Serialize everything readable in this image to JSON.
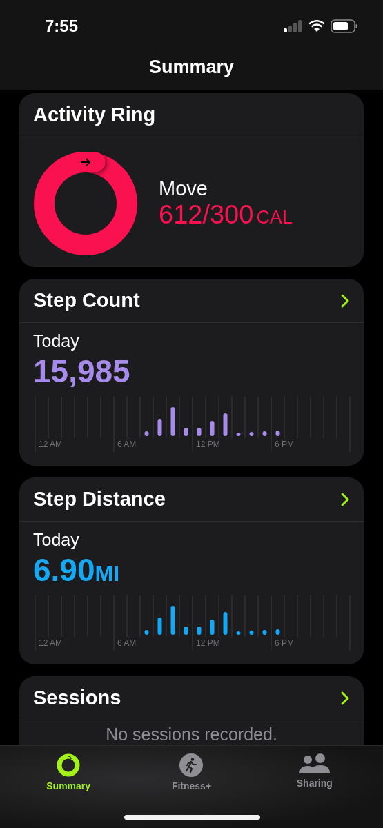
{
  "status_bar": {
    "time": "7:55"
  },
  "nav": {
    "title": "Summary"
  },
  "activity_ring": {
    "title": "Activity Ring",
    "label": "Move",
    "value": "612/300",
    "unit": "CAL"
  },
  "metrics": [
    {
      "title": "Step Count",
      "caption": "Today",
      "value": "15,985",
      "color": "#a78bea",
      "axis_labels": [
        "12 AM",
        "6 AM",
        "12 PM",
        "6 PM"
      ]
    },
    {
      "title": "Step Distance",
      "caption": "Today",
      "value": "6.90",
      "unit": "MI",
      "color": "#14a8f5",
      "axis_labels": [
        "12 AM",
        "6 AM",
        "12 PM",
        "6 PM"
      ]
    }
  ],
  "sessions": {
    "title": "Sessions",
    "empty_text": "No sessions recorded."
  },
  "tabs": [
    {
      "label": "Summary",
      "kind": "rings",
      "selected": true
    },
    {
      "label": "Fitness+",
      "kind": "runner",
      "selected": false
    },
    {
      "label": "Sharing",
      "kind": "people",
      "selected": false
    }
  ]
}
